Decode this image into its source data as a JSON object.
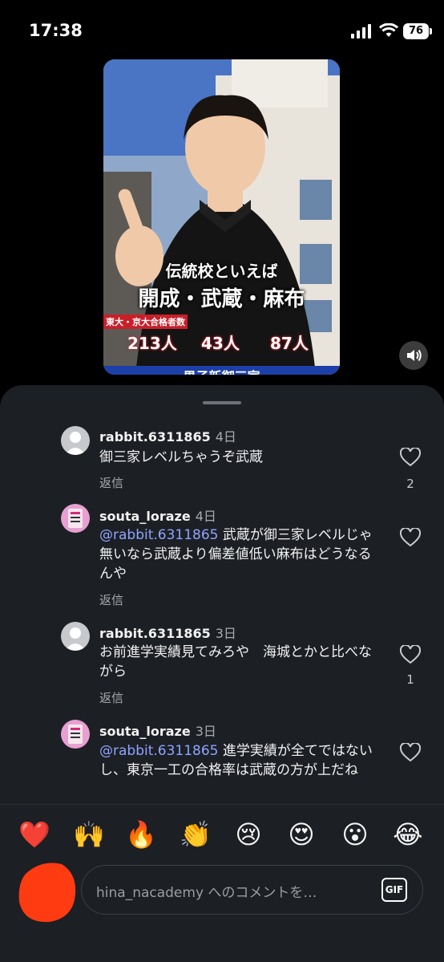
{
  "status_bar": {
    "time": "17:38",
    "battery": "76"
  },
  "video": {
    "caption_top": "伝統校といえば",
    "caption_main": "開成・武蔵・麻布",
    "stat_label": "東大・京大合格者数",
    "stats": [
      "213人",
      "43人",
      "87人"
    ],
    "caption_bottom": "男子新御三家"
  },
  "comments": [
    {
      "user": "rabbit.6311865",
      "time": "4日",
      "mention": "",
      "text": "御三家レベルちゃうぞ武蔵",
      "reply": "返信",
      "likes": "2"
    },
    {
      "user": "souta_loraze",
      "time": "4日",
      "mention": "@rabbit.6311865",
      "text": " 武蔵が御三家レベルじゃ無いなら武蔵より偏差値低い麻布はどうなるんや",
      "reply": "返信",
      "likes": ""
    },
    {
      "user": "rabbit.6311865",
      "time": "3日",
      "mention": "",
      "text": "お前進学実績見てみろや　海城とかと比べながら",
      "reply": "返信",
      "likes": "1"
    },
    {
      "user": "souta_loraze",
      "time": "3日",
      "mention": "@rabbit.6311865",
      "text": " 進学実績が全てではないし、東京一工の合格率は武蔵の方が上だね",
      "reply": "",
      "likes": ""
    }
  ],
  "reactions": [
    "❤️",
    "🙌",
    "🔥",
    "👏",
    "😢",
    "😍",
    "😮",
    "😂"
  ],
  "composer": {
    "placeholder": "hina_nacademy へのコメントを…",
    "gif_label": "GIF"
  }
}
